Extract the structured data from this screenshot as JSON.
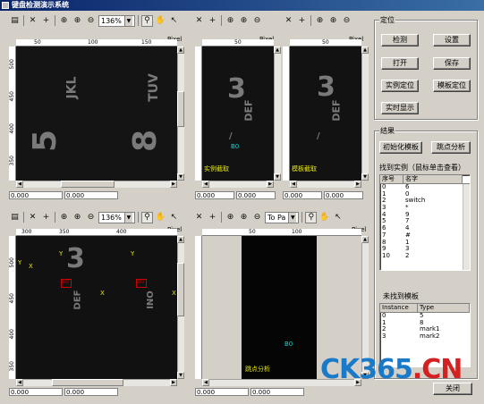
{
  "window": {
    "title": "键盘检测演示系统"
  },
  "viewers": {
    "v1": {
      "zoom": "136%",
      "unit": "Pixel",
      "hticks": [
        "50",
        "100",
        "150"
      ],
      "vticks": [
        "500",
        "450",
        "400",
        "350"
      ],
      "coord1": "0.000",
      "coord2": "0.000",
      "glyphs": [
        "JKL",
        "5",
        "TUV",
        "8"
      ]
    },
    "v2": {
      "unit": "Pixel",
      "hticks": [
        "50"
      ],
      "coord1": "0.000",
      "coord2": "0.000",
      "label": "实例截取",
      "mark": "B0",
      "glyphs": [
        "3",
        "DEF",
        "/"
      ]
    },
    "v3": {
      "unit": "Pixel",
      "hticks": [
        "50"
      ],
      "coord1": "0.000",
      "coord2": "0.000",
      "label": "模板截取",
      "glyphs": [
        "3",
        "DEF",
        "/"
      ]
    },
    "v4": {
      "zoom": "136%",
      "unit": "Pixel",
      "hticks": [
        "300",
        "350",
        "400"
      ],
      "vticks": [
        "500",
        "450",
        "400",
        "350"
      ],
      "coord1": "0.000",
      "coord2": "0.000",
      "axis_labels": [
        "Y",
        "X",
        "Y",
        "X",
        "Y",
        "X"
      ],
      "boxes": [
        "B0",
        "B0"
      ],
      "glyphs": [
        "3",
        "DEF",
        "INO"
      ]
    },
    "v5": {
      "mode_select": "To Pa",
      "unit": "Pixel",
      "hticks": [
        "50",
        "100"
      ],
      "coord1": "0.000",
      "coord2": "0.000",
      "label": "跳点分析",
      "mark": "B0"
    }
  },
  "panel": {
    "locate": {
      "title": "定位",
      "buttons": [
        "检测",
        "设置",
        "打开",
        "保存",
        "实例定位",
        "模板定位",
        "实时显示"
      ]
    },
    "result": {
      "title": "结果",
      "init_button": "初始化模板",
      "jump_button": "跳点分析",
      "found_label": "找到实例（鼠标单击查看）",
      "found_headers": [
        "序号",
        "名字"
      ],
      "found_rows": [
        [
          "0",
          "6"
        ],
        [
          "1",
          "0"
        ],
        [
          "2",
          "switch"
        ],
        [
          "3",
          "*"
        ],
        [
          "4",
          "9"
        ],
        [
          "5",
          "7"
        ],
        [
          "6",
          "4"
        ],
        [
          "7",
          "#"
        ],
        [
          "8",
          "1"
        ],
        [
          "9",
          "3"
        ],
        [
          "10",
          "2"
        ]
      ],
      "notfound_label": "未找到模板",
      "notfound_headers": [
        "Instance",
        "Type"
      ],
      "notfound_rows": [
        [
          "0",
          "5"
        ],
        [
          "1",
          "8"
        ],
        [
          "2",
          "mark1"
        ],
        [
          "3",
          "mark2"
        ]
      ]
    },
    "close_button": "关闭"
  },
  "watermark": {
    "part1": "CK365",
    "part2": ".CN"
  },
  "colors": {
    "titlebar": "#0a246a",
    "label_yellow": "#e8e800",
    "box_red": "#d00000",
    "mark_cyan": "#00e0e0",
    "watermark_blue": "#1a7ac8",
    "watermark_red": "#d42020"
  }
}
